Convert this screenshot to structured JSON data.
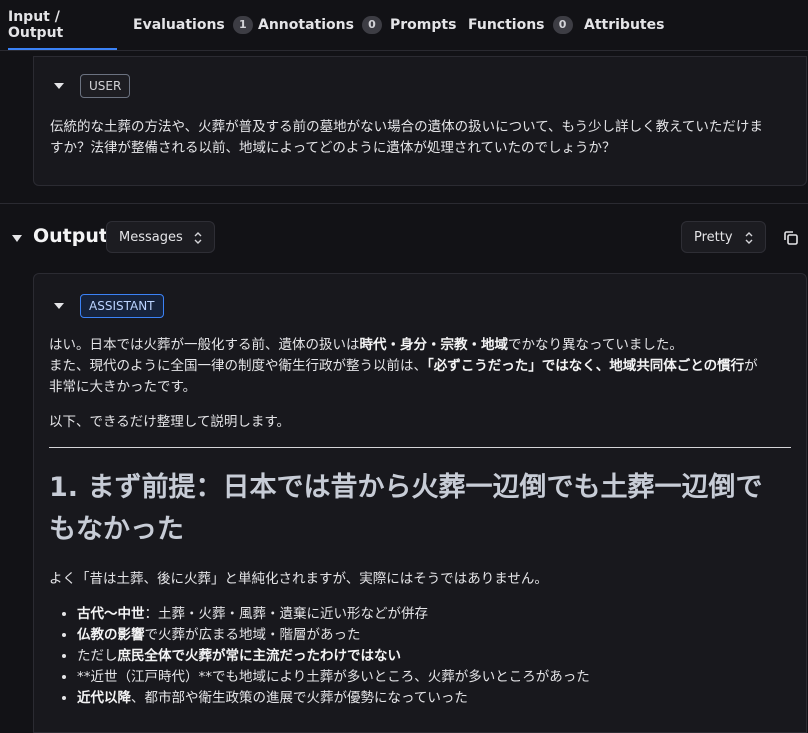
{
  "tabs": [
    {
      "label": "Input / Output",
      "active": true
    },
    {
      "label": "Evaluations",
      "count": "1"
    },
    {
      "label": "Annotations",
      "count": "0"
    },
    {
      "label": "Prompts"
    },
    {
      "label": "Functions",
      "count": "0"
    },
    {
      "label": "Attributes"
    }
  ],
  "input": {
    "role": "USER",
    "message_line1": "伝統的な土葬の方法や、火葬が普及する前の墓地がない場合の遺体の扱いについて、もう少し詳しく教えていただけま",
    "message_line2": "すか？法律が整備される以前、地域によってどのように遺体が処理されていたのでしょうか？"
  },
  "output": {
    "title": "Output",
    "format_select": "Messages",
    "render_select": "Pretty",
    "role": "ASSISTANT",
    "p1": {
      "a": "はい。日本では火葬が一般化する前、遺体の扱いは",
      "b": "時代・身分・宗教・地域",
      "c": "でかなり異なっていました。"
    },
    "p2": {
      "a": "また、現代のように全国一律の制度や衛生行政が整う以前は、",
      "b": "「必ずこうだった」ではなく、地域共同体ごとの慣行",
      "c": "が",
      "d": "非常に大きかったです。"
    },
    "p3": "以下、できるだけ整理して説明します。",
    "heading_line1": "1. まず前提：日本では昔から火葬一辺倒でも土葬一辺倒で",
    "heading_line2": "もなかった",
    "p4": "よく「昔は土葬、後に火葬」と単純化されますが、実際にはそうではありません。",
    "bullets": [
      {
        "bold": "古代〜中世",
        "rest": "：土葬・火葬・風葬・遺棄に近い形などが併存"
      },
      {
        "bold": "仏教の影響",
        "rest": "で火葬が広まる地域・階層があった"
      },
      {
        "pre": "ただし",
        "bold": "庶民全体で火葬が常に主流だったわけではない",
        "rest": ""
      },
      {
        "pre": "**近世（江戸時代）**でも地域により土葬が多いところ、火葬が多いところがあった",
        "bold": "",
        "rest": ""
      },
      {
        "bold": "近代以降",
        "rest": "、都市部や衛生政策の進展で火葬が優勢になっていった"
      }
    ]
  }
}
